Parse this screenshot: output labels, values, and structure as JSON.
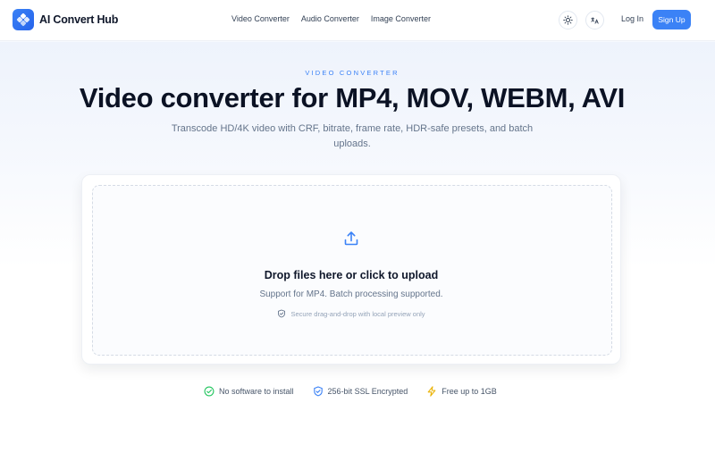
{
  "header": {
    "brand": "AI Convert Hub",
    "nav": [
      "Video Converter",
      "Audio Converter",
      "Image Converter"
    ],
    "login": "Log In",
    "signup": "Sign Up"
  },
  "hero": {
    "eyebrow": "VIDEO CONVERTER",
    "title": "Video converter for MP4, MOV, WEBM, AVI",
    "subtitle": "Transcode HD/4K video with CRF, bitrate, frame rate, HDR-safe presets, and batch uploads."
  },
  "upload": {
    "title": "Drop files here or click to upload",
    "subtitle": "Support for MP4. Batch processing supported.",
    "note": "Secure drag-and-drop with local preview only"
  },
  "features": [
    {
      "label": "No software to install",
      "icon": "check-circle-icon",
      "color": "#22c55e"
    },
    {
      "label": "256-bit SSL Encrypted",
      "icon": "shield-check-icon",
      "color": "#3b82f6"
    },
    {
      "label": "Free up to 1GB",
      "icon": "lightning-icon",
      "color": "#eab308"
    }
  ],
  "colors": {
    "accent": "#3b82f6",
    "text": "#0f172a",
    "muted": "#64748b"
  }
}
